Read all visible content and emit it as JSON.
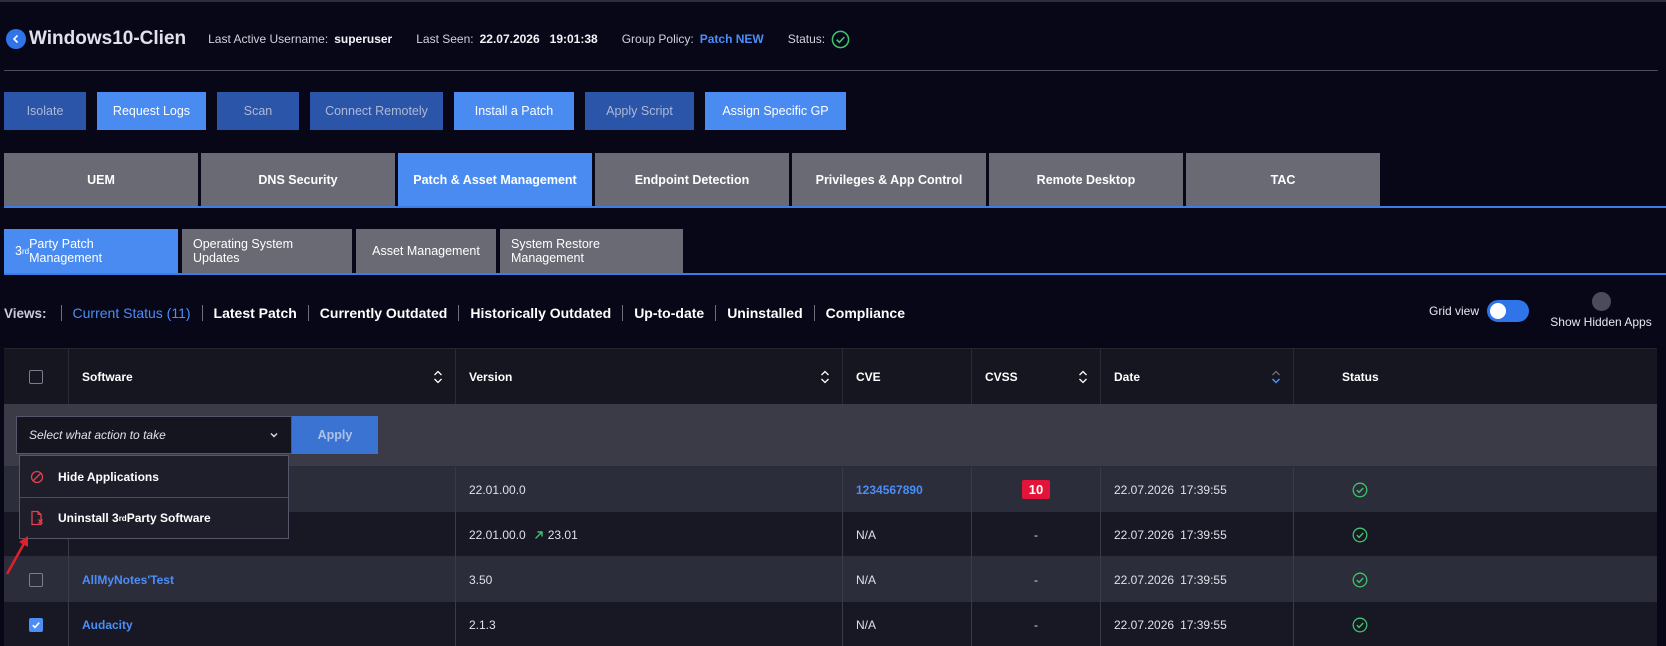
{
  "header": {
    "title": "Windows10-Clien",
    "last_active_label": "Last Active Username:",
    "last_active_value": "superuser",
    "last_seen_label": "Last Seen:",
    "last_seen_date": "22.07.2026",
    "last_seen_time": "19:01:38",
    "group_policy_label": "Group Policy:",
    "group_policy_value": "Patch NEW",
    "status_label": "Status:"
  },
  "actions": {
    "isolate": "Isolate",
    "request_logs": "Request Logs",
    "scan": "Scan",
    "connect_remotely": "Connect Remotely",
    "install_patch": "Install a Patch",
    "apply_script": "Apply Script",
    "assign_gp": "Assign Specific GP"
  },
  "main_tabs": [
    "UEM",
    "DNS Security",
    "Patch & Asset Management",
    "Endpoint Detection",
    "Privileges & App Control",
    "Remote Desktop",
    "TAC"
  ],
  "sub_tabs": {
    "third_party_pre": "3",
    "third_party_sup": "rd",
    "third_party_post": " Party Patch Management",
    "os_updates": "Operating System Updates",
    "asset": "Asset Management",
    "restore": "System Restore Management"
  },
  "views": {
    "label": "Views:",
    "items": [
      "Current Status (11)",
      "Latest Patch",
      "Currently Outdated",
      "Historically Outdated",
      "Up-to-date",
      "Uninstalled",
      "Compliance"
    ]
  },
  "grid_view_label": "Grid view",
  "show_hidden_label": "Show Hidden Apps",
  "table": {
    "headers": {
      "software": "Software",
      "version": "Version",
      "cve": "CVE",
      "cvss": "CVSS",
      "date": "Date",
      "status": "Status"
    },
    "action_placeholder": "Select what action to take",
    "apply_label": "Apply",
    "rows": [
      {
        "software": "",
        "version": "22.01.00.0",
        "update": "",
        "cve": "1234567890",
        "cvss": "10",
        "date": "22.07.2026",
        "time": "17:39:55"
      },
      {
        "software": "",
        "version": "22.01.00.0",
        "update": "23.01",
        "cve": "N/A",
        "cvss": "-",
        "date": "22.07.2026",
        "time": "17:39:55"
      },
      {
        "software": "AllMyNotes'Test",
        "version": "3.50",
        "update": "",
        "cve": "N/A",
        "cvss": "-",
        "date": "22.07.2026",
        "time": "17:39:55"
      },
      {
        "software": "Audacity",
        "version": "2.1.3",
        "update": "",
        "cve": "N/A",
        "cvss": "-",
        "date": "22.07.2026",
        "time": "17:39:55"
      }
    ]
  },
  "menu": {
    "hide": "Hide Applications",
    "uninstall_pre": "Uninstall 3",
    "uninstall_sup": "rd",
    "uninstall_post": " Party Software"
  },
  "colors": {
    "accent": "#4a8bf2",
    "success": "#3ec46d",
    "danger": "#e3143a",
    "background": "#070718"
  }
}
